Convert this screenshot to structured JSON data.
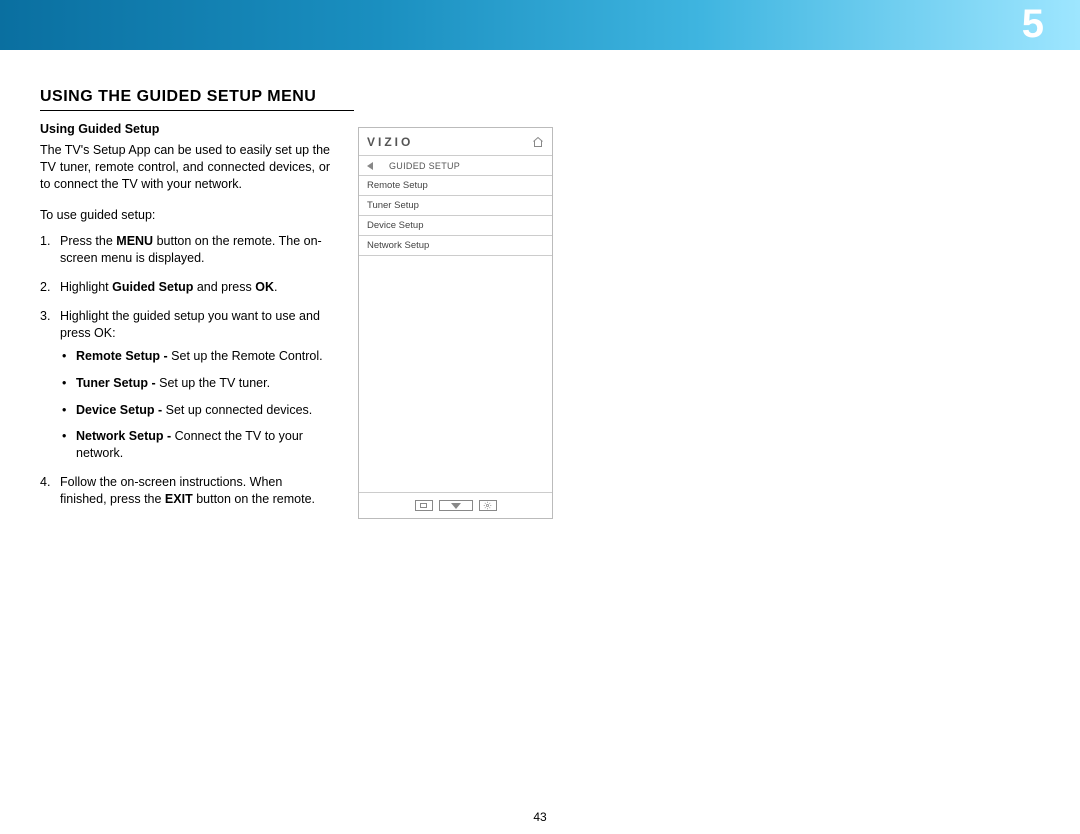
{
  "chapter_number": "5",
  "section_title": "USING THE GUIDED SETUP MENU",
  "sub_title": "Using Guided Setup",
  "intro": "The TV's Setup App can be used to easily set up the TV tuner, remote control, and connected devices, or to connect the TV with your network.",
  "lead": "To use guided setup:",
  "steps": {
    "s1a": "Press the ",
    "s1b": "MENU",
    "s1c": " button on the remote. The on-screen menu is displayed.",
    "s2a": "Highlight ",
    "s2b": "Guided Setup",
    "s2c": " and press ",
    "s2d": "OK",
    "s2e": ".",
    "s3": "Highlight the guided setup you want to use and press OK:",
    "b1b": "Remote Setup - ",
    "b1r": "Set up the Remote Control.",
    "b2b": "Tuner Setup - ",
    "b2r": "Set up the TV tuner.",
    "b3b": "Device Setup - ",
    "b3r": "Set up connected devices.",
    "b4b": "Network Setup - ",
    "b4r": "Connect the TV to your network.",
    "s4a": "Follow the on-screen instructions. When finished, press the ",
    "s4b": "EXIT",
    "s4c": " button on the remote."
  },
  "panel": {
    "brand": "VIZIO",
    "title": "GUIDED SETUP",
    "rows": [
      "Remote Setup",
      "Tuner Setup",
      "Device Setup",
      "Network Setup"
    ]
  },
  "page_number": "43"
}
